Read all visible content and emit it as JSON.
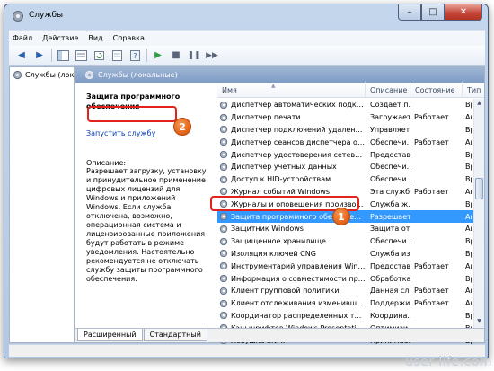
{
  "window": {
    "title": "Службы"
  },
  "menu": [
    "Файл",
    "Действие",
    "Вид",
    "Справка"
  ],
  "tree": {
    "item": "Службы (локальные)"
  },
  "pane": {
    "header": "Службы (локальные)"
  },
  "description": {
    "title": "Защита программного обеспечения",
    "start_link": "Запустить",
    "start_suffix": " службу",
    "label": "Описание:",
    "text": "Разрешает загрузку, установку и принудительное применение цифровых лицензий для Windows и приложений Windows. Если служба отключена, возможно, операционная система и лицензированные приложения будут работать в режиме уведомления. Настоятельно рекомендуется не отключать службу защиты программного обеспечения."
  },
  "columns": {
    "name": "Имя",
    "desc": "Описание",
    "status": "Состояние",
    "type": "Тип запуска"
  },
  "rows": [
    {
      "name": "Диспетчер автоматических подключе...",
      "desc": "Создает п...",
      "status": "",
      "type": "Вр"
    },
    {
      "name": "Диспетчер печати",
      "desc": "Загружает...",
      "status": "Работает",
      "type": "Ав"
    },
    {
      "name": "Диспетчер подключений удаленного до...",
      "desc": "Управляет...",
      "status": "",
      "type": "Вр"
    },
    {
      "name": "Диспетчер сеансов диспетчера окон ...",
      "desc": "Обеспечи...",
      "status": "Работает",
      "type": "Ав"
    },
    {
      "name": "Диспетчер удостоверения сетевых участ...",
      "desc": "Предостав...",
      "status": "",
      "type": "Вр"
    },
    {
      "name": "Диспетчер учетных данных",
      "desc": "Обеспечи...",
      "status": "",
      "type": "Вр"
    },
    {
      "name": "Доступ к HID-устройствам",
      "desc": "Обеспечи...",
      "status": "",
      "type": "Вр"
    },
    {
      "name": "Журнал событий Windows",
      "desc": "Эта служб...",
      "status": "Работает",
      "type": "Ав"
    },
    {
      "name": "Журналы и оповещения производитель...",
      "desc": "Служба ж...",
      "status": "",
      "type": "Вр"
    },
    {
      "name": "Защита программного обеспечения",
      "desc": "Разрешает...",
      "status": "",
      "type": "Ав"
    },
    {
      "name": "Защитник Windows",
      "desc": "Защита от...",
      "status": "",
      "type": "Ав"
    },
    {
      "name": "Защищенное хранилище",
      "desc": "Обеспечи...",
      "status": "",
      "type": "Вр"
    },
    {
      "name": "Изоляция ключей CNG",
      "desc": "Служба из...",
      "status": "",
      "type": "Вр"
    },
    {
      "name": "Инструментарий управления Windows",
      "desc": "Предостав...",
      "status": "Работает",
      "type": "Ав"
    },
    {
      "name": "Информация о совместимости приложе...",
      "desc": "Обработка...",
      "status": "",
      "type": "Вр"
    },
    {
      "name": "Клиент групповой политики",
      "desc": "Данная сл...",
      "status": "Работает",
      "type": "Ав"
    },
    {
      "name": "Клиент отслеживания изменившихся св...",
      "desc": "Поддержи...",
      "status": "Работает",
      "type": "Ав"
    },
    {
      "name": "Координатор распределенных транзакций",
      "desc": "Координа...",
      "status": "",
      "type": "Вр"
    },
    {
      "name": "Кэш шрифтов Windows Presentation Fou...",
      "desc": "Оптимизи...",
      "status": "",
      "type": "Вр"
    },
    {
      "name": "Ловушка SNMP",
      "desc": "Принимае...",
      "status": "",
      "type": "Вр"
    }
  ],
  "tabs": [
    "Расширенный",
    "Стандартный"
  ],
  "callouts": {
    "one": "1",
    "two": "2"
  },
  "watermark": "user-life.com",
  "colors": {
    "selection": "#3399ff",
    "callout_border": "#e3231b",
    "badge": "#e06014"
  }
}
